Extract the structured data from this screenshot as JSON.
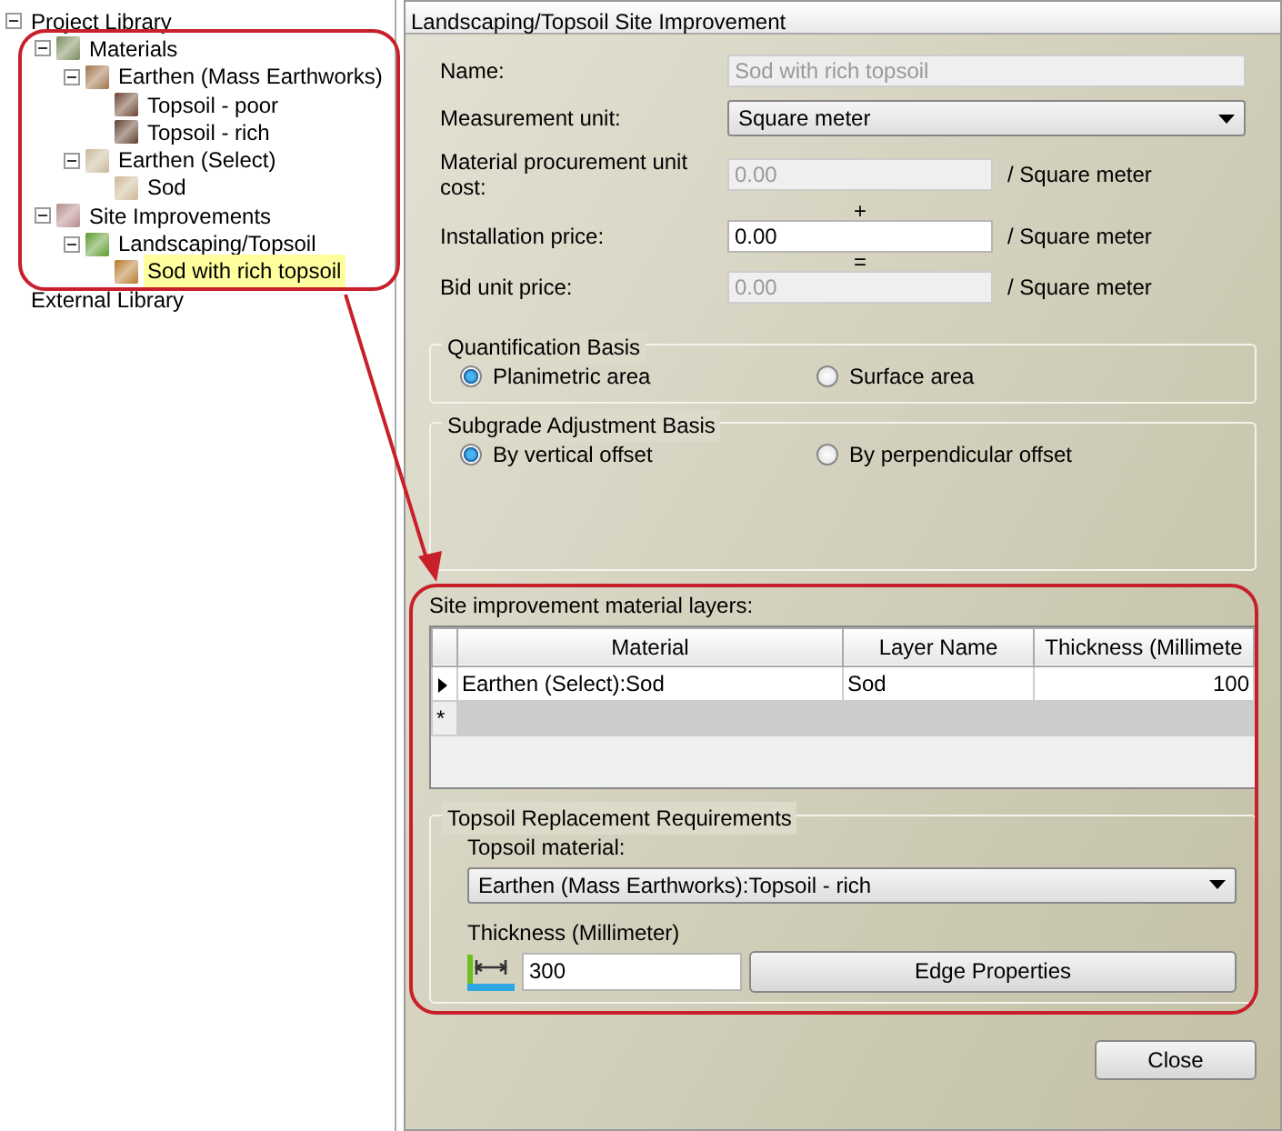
{
  "tree": [
    {
      "label": "Project Library",
      "expanded": true,
      "selected": false,
      "children": [
        {
          "label": "Materials",
          "color": "#7a8a5a",
          "expanded": true,
          "selected": false,
          "children": [
            {
              "label": "Earthen (Mass Earthworks)",
              "color": "#a0724a",
              "expanded": true,
              "selected": false,
              "children": [
                {
                  "label": "Topsoil - poor",
                  "color": "#6b4430",
                  "selected": false
                },
                {
                  "label": "Topsoil - rich",
                  "color": "#5e3f2c",
                  "selected": false
                }
              ]
            },
            {
              "label": "Earthen (Select)",
              "color": "#c9b89a",
              "expanded": true,
              "selected": false,
              "children": [
                {
                  "label": "Sod",
                  "color": "#cbb894",
                  "selected": false
                }
              ]
            }
          ]
        },
        {
          "label": "Site Improvements",
          "color": "#b58a8a",
          "expanded": true,
          "selected": false,
          "children": [
            {
              "label": "Landscaping/Topsoil",
              "color": "#5a9a2a",
              "expanded": true,
              "selected": false,
              "children": [
                {
                  "label": "Sod with rich topsoil",
                  "color": "#b8782a",
                  "selected": true
                }
              ]
            }
          ]
        }
      ]
    },
    {
      "label": "External Library",
      "selected": false
    }
  ],
  "panel": {
    "title": "Landscaping/Topsoil Site Improvement",
    "fields": [
      {
        "kind": "text",
        "label": "Name:",
        "value": "Sod with rich topsoil",
        "disabled": true
      },
      {
        "kind": "select",
        "label": "Measurement unit:",
        "value": "Square meter"
      },
      {
        "kind": "text",
        "label": "Material procurement unit cost:",
        "value": "0.00",
        "disabled": true,
        "unit": "/ Square meter",
        "operator": "+"
      },
      {
        "kind": "text",
        "label": "Installation price:",
        "value": "0.00",
        "disabled": false,
        "unit": "/ Square meter",
        "operator": "="
      },
      {
        "kind": "text",
        "label": "Bid unit price:",
        "value": "0.00",
        "disabled": true,
        "unit": "/ Square meter"
      }
    ],
    "groups": [
      {
        "title": "Quantification Basis",
        "options": [
          {
            "label": "Planimetric area",
            "selected": true
          },
          {
            "label": "Surface area",
            "selected": false
          }
        ]
      },
      {
        "title": "Subgrade Adjustment Basis",
        "options": [
          {
            "label": "By vertical offset",
            "selected": true
          },
          {
            "label": "By perpendicular offset",
            "selected": false
          }
        ]
      }
    ],
    "layers": {
      "label": "Site improvement material layers:",
      "columns": [
        "Material",
        "Layer Name",
        "Thickness (Millimete"
      ],
      "rows": [
        {
          "cells": [
            "Earthen (Select):Sod",
            "Sod",
            "100"
          ],
          "current": true
        }
      ],
      "new_row_marker": "*"
    },
    "topsoil": {
      "title": "Topsoil Replacement Requirements",
      "material_label": "Topsoil material:",
      "material": "Earthen (Mass Earthworks):Topsoil - rich",
      "thickness_label": "Thickness (Millimeter)",
      "thickness": "300",
      "edge_button": "Edge Properties"
    },
    "close_button": "Close"
  }
}
